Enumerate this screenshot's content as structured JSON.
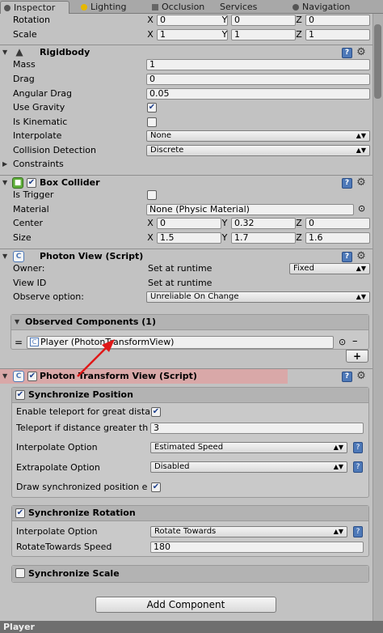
{
  "tabs": [
    "Inspector",
    "Lighting",
    "Occlusion",
    "Services",
    "Navigation"
  ],
  "transform": {
    "rotation_label": "Rotation",
    "scale_label": "Scale",
    "rotation": {
      "x": "0",
      "y": "0",
      "z": "0"
    },
    "scale": {
      "x": "1",
      "y": "1",
      "z": "1"
    }
  },
  "axes": {
    "x": "X",
    "y": "Y",
    "z": "Z"
  },
  "rigidbody": {
    "title": "Rigidbody",
    "mass_label": "Mass",
    "mass": "1",
    "drag_label": "Drag",
    "drag": "0",
    "angular_drag_label": "Angular Drag",
    "angular_drag": "0.05",
    "use_gravity_label": "Use Gravity",
    "use_gravity": true,
    "is_kinematic_label": "Is Kinematic",
    "is_kinematic": false,
    "interpolate_label": "Interpolate",
    "interpolate": "None",
    "collision_label": "Collision Detection",
    "collision": "Discrete",
    "constraints_label": "Constraints"
  },
  "box_collider": {
    "title": "Box Collider",
    "is_trigger_label": "Is Trigger",
    "is_trigger": false,
    "material_label": "Material",
    "material": "None (Physic Material)",
    "center_label": "Center",
    "center": {
      "x": "0",
      "y": "0.32",
      "z": "0"
    },
    "size_label": "Size",
    "size": {
      "x": "1.5",
      "y": "1.7",
      "z": "1.6"
    }
  },
  "photon_view": {
    "title": "Photon View (Script)",
    "owner_label": "Owner:",
    "owner_value": "Set at runtime",
    "owner_dropdown": "Fixed",
    "viewid_label": "View ID",
    "viewid_value": "Set at runtime",
    "observe_label": "Observe option:",
    "observe": "Unreliable On Change",
    "observed_title": "Observed Components (1)",
    "observed_item": "Player (PhotonTransformView)",
    "handle": "=",
    "remove": "–",
    "add": "+"
  },
  "photon_transform": {
    "title": "Photon Transform View (Script)",
    "sync_position": {
      "title": "Synchronize Position",
      "enabled": true,
      "teleport_enable_label": "Enable teleport for great dista",
      "teleport_enable": true,
      "teleport_dist_label": "Teleport if distance greater th",
      "teleport_dist": "3",
      "interp_label": "Interpolate Option",
      "interp": "Estimated Speed",
      "extrap_label": "Extrapolate Option",
      "extrap": "Disabled",
      "draw_label": "Draw synchronized position e",
      "draw": true
    },
    "sync_rotation": {
      "title": "Synchronize Rotation",
      "enabled": true,
      "interp_label": "Interpolate Option",
      "interp": "Rotate Towards",
      "speed_label": "RotateTowards Speed",
      "speed": "180"
    },
    "sync_scale": {
      "title": "Synchronize Scale",
      "enabled": false
    }
  },
  "add_component": "Add Component",
  "footer": "Player",
  "colors": {
    "highlight": "#d9a8a8",
    "arrow": "#e01818",
    "help": "#4e79b8"
  }
}
